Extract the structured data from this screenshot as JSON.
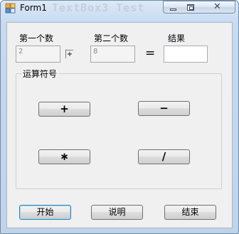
{
  "window": {
    "title": "Form1",
    "ghost_title": "TextBox3 Test"
  },
  "inputs": {
    "first_label": "第一个数",
    "second_label": "第二个数",
    "result_label": "结果",
    "first_value": "2",
    "second_value": "8",
    "result_value": "",
    "operator_value": "+",
    "equals_sign": "="
  },
  "operator_group": {
    "title": "运算符号",
    "plus": "+",
    "minus": "−",
    "multiply": "∗",
    "divide": "/"
  },
  "actions": {
    "start": "开始",
    "help": "说明",
    "end": "结束"
  }
}
